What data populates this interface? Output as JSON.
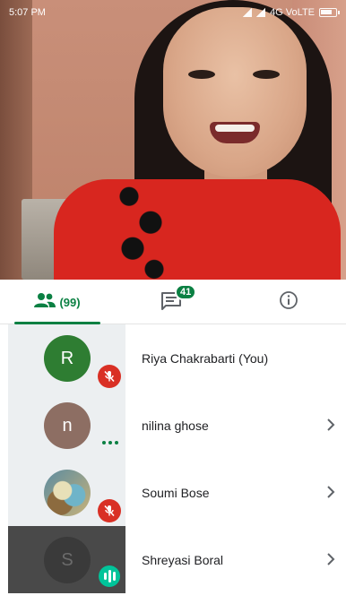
{
  "status_bar": {
    "time": "5:07 PM",
    "network": "4G VoLTE"
  },
  "tabs": {
    "people_count": "(99)",
    "chat_badge": "41"
  },
  "colors": {
    "accent": "#0b8043",
    "muted_red": "#d93025",
    "speaking": "#00c49a"
  },
  "participants": [
    {
      "initial": "R",
      "name": "Riya Chakrabarti (You)",
      "avatar_color": "#2e7d32",
      "status": "muted"
    },
    {
      "initial": "n",
      "name": "nilina ghose",
      "avatar_color": "#8d6e63",
      "status": "connecting"
    },
    {
      "initial": "",
      "name": "Soumi Bose",
      "avatar_color": "#5c8ca0",
      "status": "muted"
    },
    {
      "initial": "S",
      "name": "Shreyasi Boral",
      "avatar_color": "#3a3a3a",
      "status": "speaking"
    }
  ],
  "icons": {
    "people": "people-icon",
    "chat": "chat-icon",
    "info": "info-icon",
    "mic_off": "mic-off-icon",
    "chevron": "chevron-right-icon"
  }
}
